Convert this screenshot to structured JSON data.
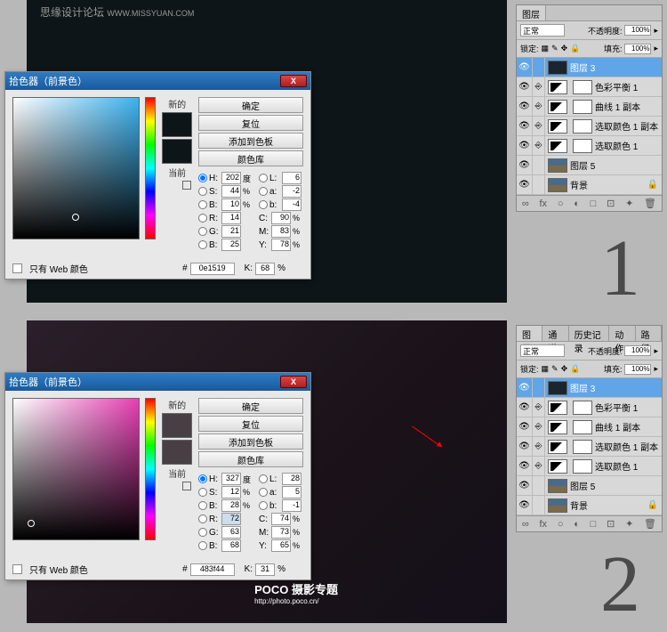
{
  "watermark": {
    "text1": "思缘设计论坛",
    "url1": "WWW.MISSYUAN.COM",
    "text2": "POCO 摄影专题",
    "url2": "http://photo.poco.cn/"
  },
  "numbers": {
    "one": "1",
    "two": "2"
  },
  "picker": {
    "title": "拾色器（前景色）",
    "new": "新的",
    "current": "当前",
    "btns": {
      "ok": "确定",
      "cancel": "复位",
      "add": "添加到色板",
      "lib": "颜色库"
    },
    "webonly": "只有 Web 颜色",
    "p1": {
      "H": "202",
      "S": "44",
      "B": "10",
      "R": "14",
      "G": "21",
      "Bb": "25",
      "L": "6",
      "a": "-2",
      "b": "-4",
      "C": "90",
      "M": "83",
      "Y": "78",
      "K": "68",
      "hex": "0e1519"
    },
    "p2": {
      "H": "327",
      "S": "12",
      "B": "28",
      "R": "72",
      "G": "63",
      "Bb": "68",
      "L": "28",
      "a": "5",
      "b": "-1",
      "C": "74",
      "M": "73",
      "Y": "65",
      "K": "31",
      "hex": "483f44"
    },
    "labels": {
      "H": "H:",
      "S": "S:",
      "B": "B:",
      "R": "R:",
      "G": "G:",
      "Bb": "B:",
      "L": "L:",
      "a": "a:",
      "b": "b:",
      "C": "C:",
      "M": "M:",
      "Y": "Y:",
      "K": "K:",
      "deg": "度",
      "pct": "%",
      "hash": "#"
    }
  },
  "layers": {
    "tabs": {
      "layers": "图层",
      "channels": "通道",
      "history": "历史记录",
      "actions": "动作",
      "paths": "路径"
    },
    "mode": "正常",
    "opacity_lbl": "不透明度:",
    "opacity": "100%",
    "lock": "锁定:",
    "fill_lbl": "填充:",
    "fill": "100%",
    "items": [
      {
        "name": "图层 3",
        "sel": true,
        "thumb": "th-dark"
      },
      {
        "name": "色彩平衡 1",
        "adj": true
      },
      {
        "name": "曲线 1 副本",
        "adj": true
      },
      {
        "name": "选取颜色 1 副本",
        "adj": true
      },
      {
        "name": "选取颜色 1",
        "adj": true
      },
      {
        "name": "图层 5",
        "thumb": "th-img"
      },
      {
        "name": "背景",
        "thumb": "th-img",
        "locked": true
      }
    ],
    "foot": [
      "∞",
      "fx",
      "○",
      "◐",
      "□",
      "⊡",
      "✦",
      "🗑"
    ]
  }
}
